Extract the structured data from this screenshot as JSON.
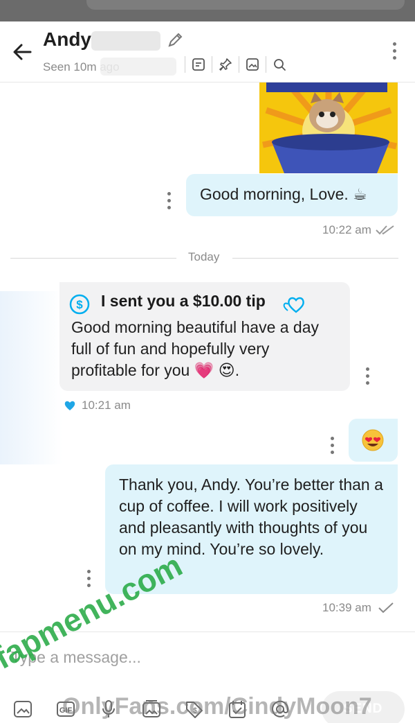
{
  "header": {
    "contact_name": "Andy",
    "seen_text": "Seen 10m ago"
  },
  "messages": {
    "m1_text": "Good morning, Love. ☕",
    "m1_time": "10:22 am",
    "divider_label": "Today",
    "tip_title": "I sent you a $10.00 tip",
    "tip_text": "Good morning beautiful have a day full of fun and hopefully very profitable for you 💗 😍.",
    "tip_time": "10:21 am",
    "m3_emoji": "😍",
    "m4_text": "Thank you, Andy. You’re better than a cup of coffee. I will work positively and pleasantly with thoughts of you on my mind. You’re so lovely.",
    "m4_time": "10:39 am"
  },
  "composer": {
    "placeholder": "Type a message...",
    "send_label": "SEND"
  },
  "watermark": {
    "text1": "fapmenu.com",
    "text2": "OnlyFans.com/CindyMoon7"
  },
  "colors": {
    "outgoing_bubble": "#dff4fb",
    "incoming_bubble": "#f2f2f3",
    "accent": "#00aeef"
  }
}
